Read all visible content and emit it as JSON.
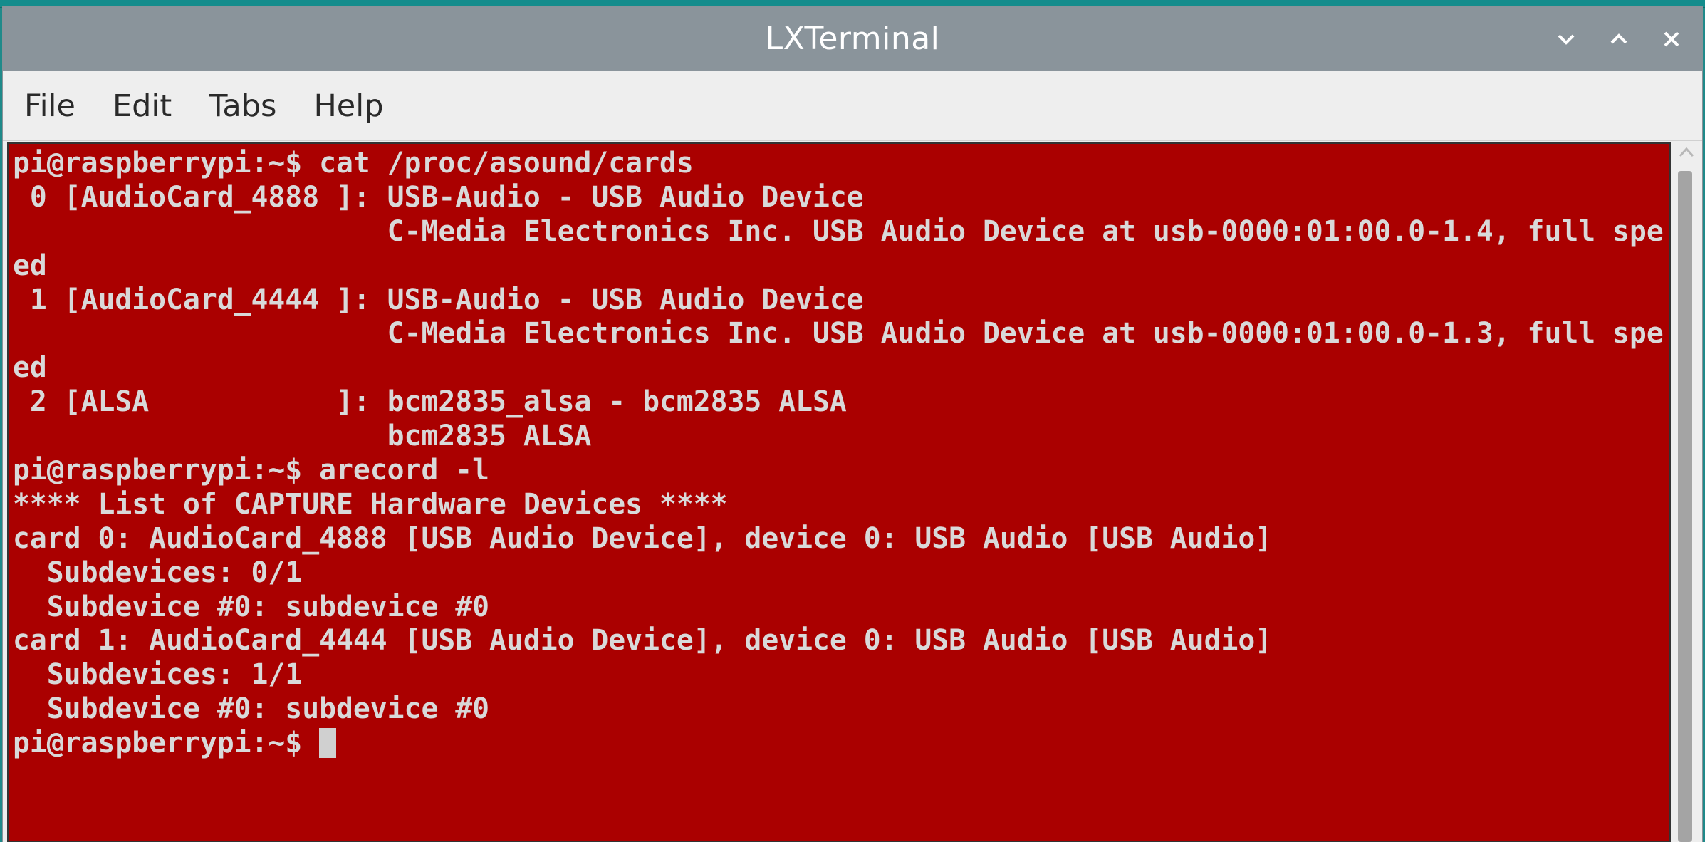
{
  "window": {
    "title": "LXTerminal"
  },
  "menu": {
    "items": [
      "File",
      "Edit",
      "Tabs",
      "Help"
    ]
  },
  "terminal": {
    "lines": [
      "pi@raspberrypi:~$ cat /proc/asound/cards",
      " 0 [AudioCard_4888 ]: USB-Audio - USB Audio Device",
      "                      C-Media Electronics Inc. USB Audio Device at usb-0000:01:00.0-1.4, full spe",
      "ed",
      " 1 [AudioCard_4444 ]: USB-Audio - USB Audio Device",
      "                      C-Media Electronics Inc. USB Audio Device at usb-0000:01:00.0-1.3, full spe",
      "ed",
      " 2 [ALSA           ]: bcm2835_alsa - bcm2835 ALSA",
      "                      bcm2835 ALSA",
      "pi@raspberrypi:~$ arecord -l",
      "**** List of CAPTURE Hardware Devices ****",
      "card 0: AudioCard_4888 [USB Audio Device], device 0: USB Audio [USB Audio]",
      "  Subdevices: 0/1",
      "  Subdevice #0: subdevice #0",
      "card 1: AudioCard_4444 [USB Audio Device], device 0: USB Audio [USB Audio]",
      "  Subdevices: 1/1",
      "  Subdevice #0: subdevice #0"
    ],
    "prompt": "pi@raspberrypi:~$ "
  },
  "icons": {
    "minimize": "chevron-down-icon",
    "maximize": "chevron-up-icon",
    "close": "close-icon"
  },
  "colors": {
    "terminal_bg": "#aa0000",
    "terminal_fg": "#d9d9d9",
    "titlebar_bg": "#8a949b"
  }
}
